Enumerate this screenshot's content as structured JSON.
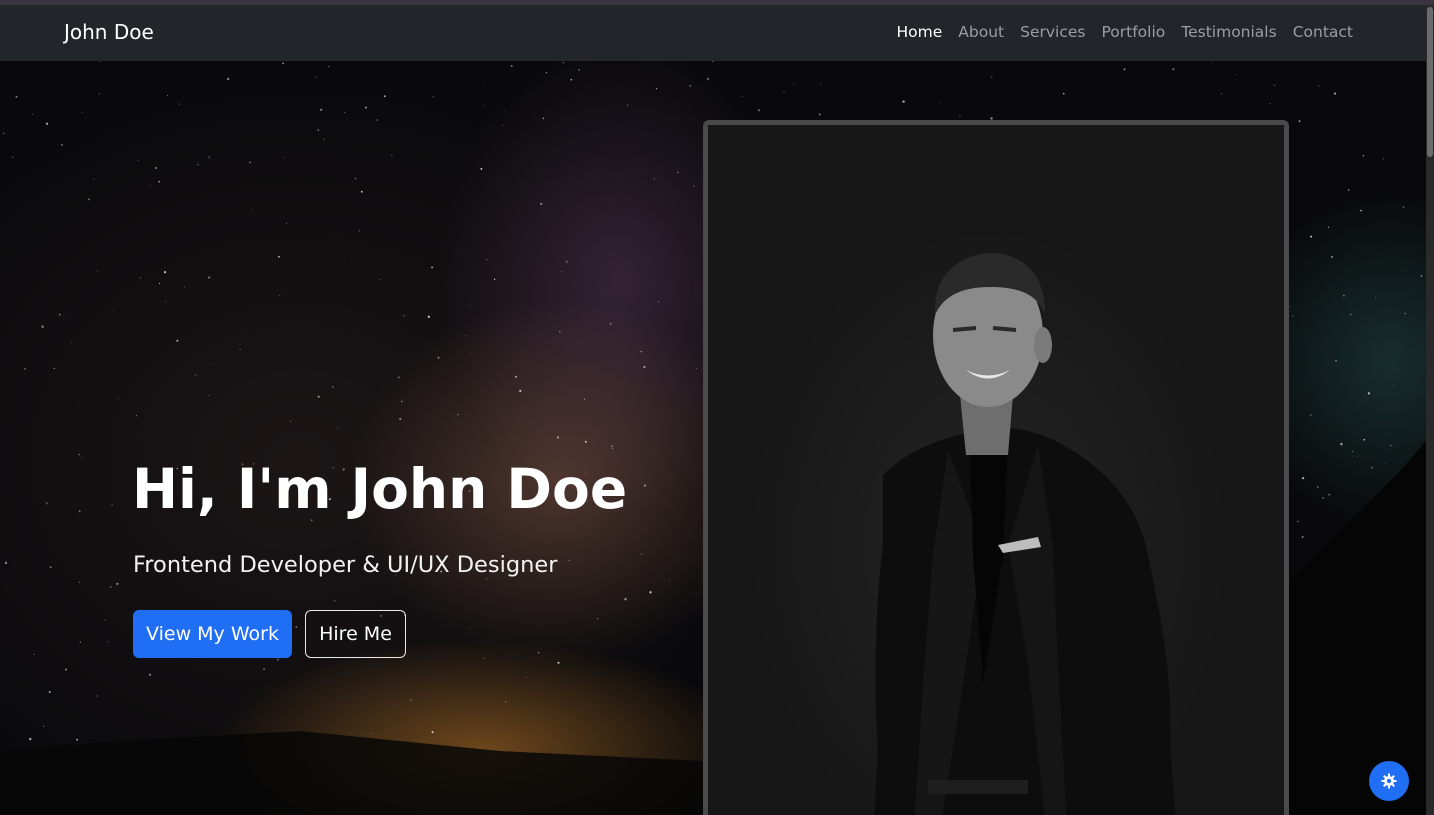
{
  "navbar": {
    "brand": "John Doe",
    "links": [
      {
        "label": "Home",
        "active": true
      },
      {
        "label": "About",
        "active": false
      },
      {
        "label": "Services",
        "active": false
      },
      {
        "label": "Portfolio",
        "active": false
      },
      {
        "label": "Testimonials",
        "active": false
      },
      {
        "label": "Contact",
        "active": false
      }
    ]
  },
  "hero": {
    "title": "Hi, I'm John Doe",
    "subtitle": "Frontend Developer & UI/UX Designer",
    "primary_button": "View My Work",
    "secondary_button": "Hire Me"
  },
  "floating_button": {
    "icon": "gear-icon"
  },
  "colors": {
    "accent": "#1f6ef3",
    "navbar_bg": "#22252a",
    "nav_link": "#9a9ea4",
    "nav_link_active": "#ffffff"
  }
}
